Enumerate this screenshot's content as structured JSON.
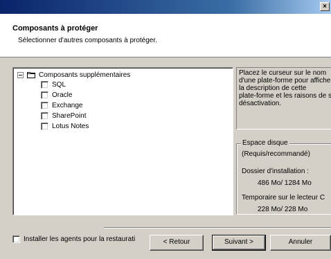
{
  "window": {
    "close_label": "×"
  },
  "header": {
    "title": "Composants à protéger",
    "subtitle": "Sélectionner d'autres composants à protéger."
  },
  "tree": {
    "root": {
      "label": "Composants supplémentaires",
      "icon": "folder-icon",
      "expander": "minus"
    },
    "items": [
      {
        "label": "SQL",
        "checked": false
      },
      {
        "label": "Oracle",
        "checked": false
      },
      {
        "label": "Exchange",
        "checked": false
      },
      {
        "label": "SharePoint",
        "checked": false
      },
      {
        "label": "Lotus Notes",
        "checked": false
      }
    ]
  },
  "info": {
    "lines": [
      "Placez le curseur sur le nom",
      "d'une plate-forme pour afficher",
      "la description de cette",
      "plate-forme et les raisons de sa",
      "désactivation."
    ]
  },
  "disk": {
    "legend": "Espace disque",
    "required_label": "(Requis/recommandé)",
    "install_label": "Dossier d'installation :",
    "install_value": "486 Mo/ 1284 Mo",
    "temp_label": "Temporaire sur le lecteur C",
    "temp_value": "228 Mo/ 228 Mo"
  },
  "footer": {
    "install_agents_label": "Installer les agents pour la restaurati",
    "install_agents_checked": false,
    "back_label": "< Retour",
    "next_label": "Suivant >",
    "cancel_label": "Annuler"
  }
}
